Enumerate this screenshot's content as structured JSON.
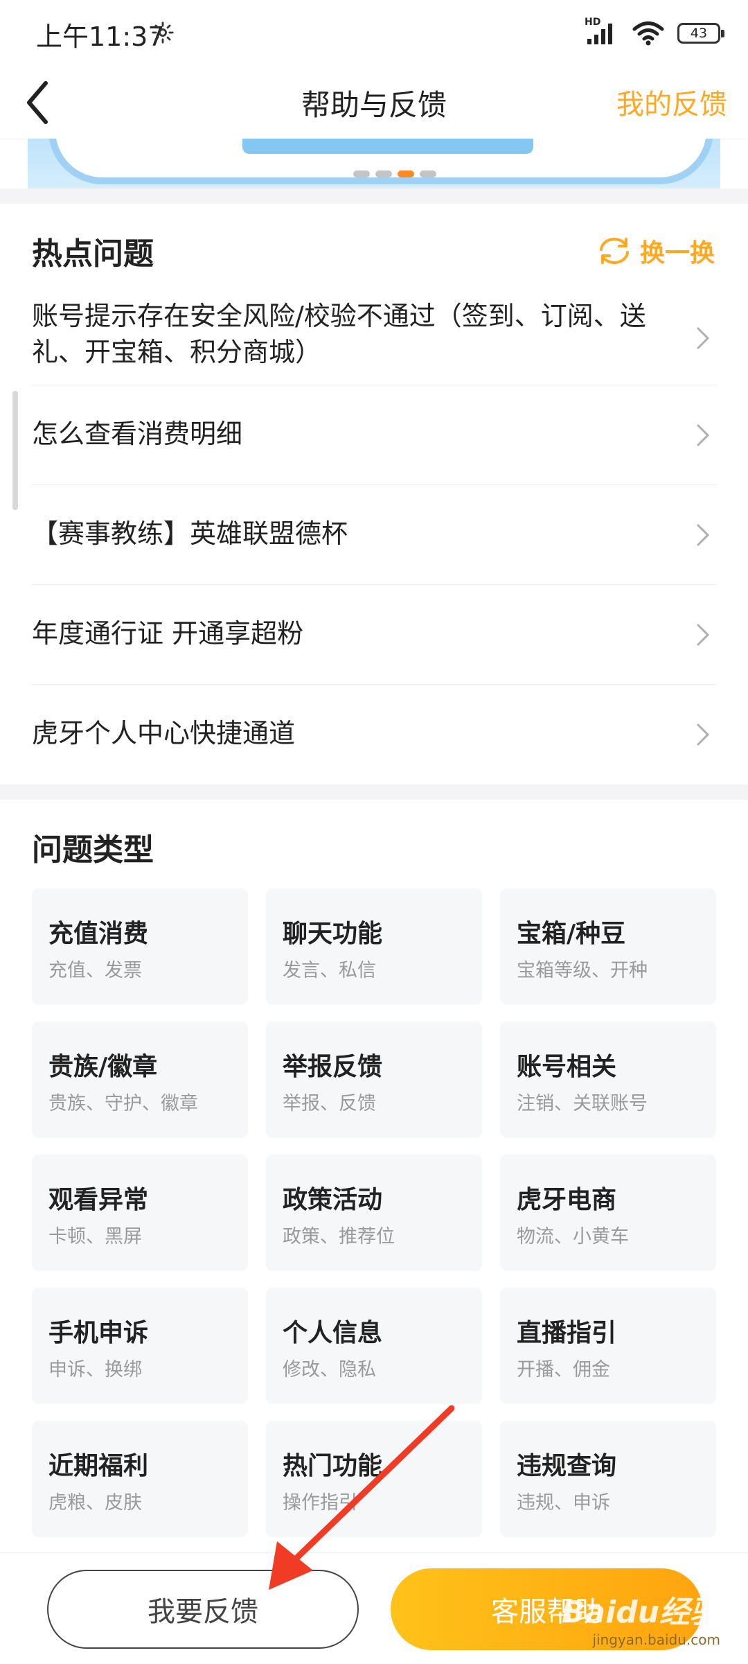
{
  "status": {
    "time": "上午11:37",
    "hd_label": "HD",
    "battery": "43"
  },
  "nav": {
    "title": "帮助与反馈",
    "right_action": "我的反馈"
  },
  "banner": {
    "dots": 4,
    "active_index": 2
  },
  "hot": {
    "title": "热点问题",
    "refresh_label": "换一换",
    "questions": [
      "账号提示存在安全风险/校验不通过（签到、订阅、送礼、开宝箱、积分商城）",
      "怎么查看消费明细",
      "【赛事教练】英雄联盟德杯",
      "年度通行证 开通享超粉",
      "虎牙个人中心快捷通道"
    ]
  },
  "categories": {
    "title": "问题类型",
    "items": [
      {
        "title": "充值消费",
        "sub": "充值、发票"
      },
      {
        "title": "聊天功能",
        "sub": "发言、私信"
      },
      {
        "title": "宝箱/种豆",
        "sub": "宝箱等级、开种"
      },
      {
        "title": "贵族/徽章",
        "sub": "贵族、守护、徽章"
      },
      {
        "title": "举报反馈",
        "sub": "举报、反馈"
      },
      {
        "title": "账号相关",
        "sub": "注销、关联账号"
      },
      {
        "title": "观看异常",
        "sub": "卡顿、黑屏"
      },
      {
        "title": "政策活动",
        "sub": "政策、推荐位"
      },
      {
        "title": "虎牙电商",
        "sub": "物流、小黄车"
      },
      {
        "title": "手机申诉",
        "sub": "申诉、换绑"
      },
      {
        "title": "个人信息",
        "sub": "修改、隐私"
      },
      {
        "title": "直播指引",
        "sub": "开播、佣金"
      },
      {
        "title": "近期福利",
        "sub": "虎粮、皮肤"
      },
      {
        "title": "热门功能",
        "sub": "操作指引"
      },
      {
        "title": "违规查询",
        "sub": "违规、申诉"
      }
    ]
  },
  "bottom": {
    "feedback_label": "我要反馈",
    "service_label": "客服帮助"
  },
  "watermark": {
    "logo": "Baidu经验",
    "sub": "jingyan.baidu.com"
  },
  "colors": {
    "accent": "#ffa820",
    "annotation_arrow": "#f03c24"
  }
}
